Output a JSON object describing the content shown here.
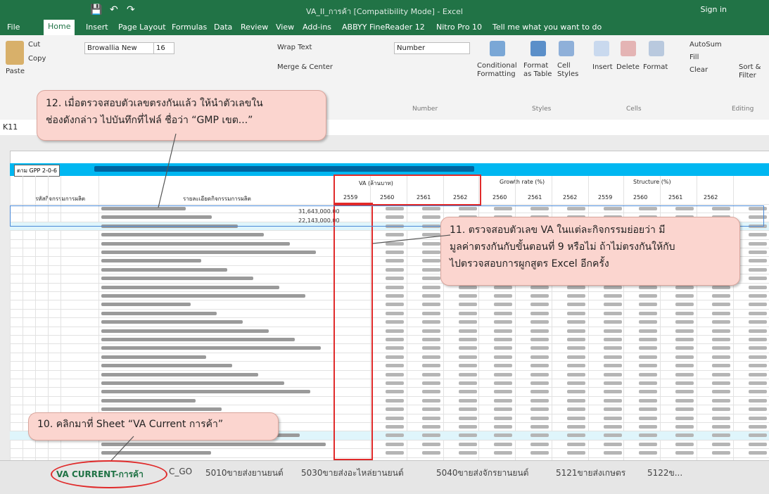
{
  "window": {
    "title": "VA_II_การค้า [Compatibility Mode] - Excel",
    "sign_in": "Sign in",
    "qa_save": "💾",
    "qa_undo": "↶",
    "qa_redo": "↷"
  },
  "ribbon_tabs": [
    "File",
    "Home",
    "Insert",
    "Page Layout",
    "Formulas",
    "Data",
    "Review",
    "View",
    "Add-ins",
    "ABBYY FineReader 12",
    "Nitro Pro 10",
    "Tell me what you want to do"
  ],
  "ribbon": {
    "cut": "Cut",
    "copy": "Copy",
    "paste": "Paste",
    "font_name": "Browallia New",
    "font_size": "16",
    "wrap_text": "Wrap Text",
    "merge_center": "Merge & Center",
    "number_format": "Number",
    "conditional_formatting": "Conditional Formatting",
    "format_as_table": "Format as Table",
    "cell_styles": "Cell Styles",
    "insert": "Insert",
    "delete": "Delete",
    "format": "Format",
    "autosum": "AutoSum",
    "fill": "Fill",
    "clear": "Clear",
    "sort_filter": "Sort & Filter",
    "group_styles": "Styles",
    "group_cells": "Cells",
    "group_editing": "Editing",
    "group_number": "Number"
  },
  "formula_bar": {
    "name_box": "K11"
  },
  "sheet": {
    "code": "ตาม GPP 2-0-6",
    "header_va": "VA (ล้านบาท)",
    "header_growth": "Growth rate (%)",
    "header_structure": "Structure (%)",
    "col_code": "รหัสกิจกรรมการผลิต",
    "col_name": "รายละเอียดกิจกรรมการผลิต",
    "years": [
      "2559",
      "2560",
      "2561",
      "2562"
    ],
    "row1_value": "31,643,000.00",
    "row2_value": "22,143,000.00"
  },
  "callouts": {
    "c12_line1": "12. เมื่อตรวจสอบตัวเลขตรงกันแล้ว ให้นำตัวเลขใน",
    "c12_line2": "ช่องดังกล่าว ไปบันทึกที่ไฟล์ ชื่อว่า “GMP เขต...”",
    "c11_line1": "11. ตรวจสอบตัวเลข VA ในแต่ละกิจกรรมย่อยว่า มี",
    "c11_line2": "มูลค่าตรงกันกับขั้นตอนที่ 9 หรือไม่ ถ้าไม่ตรงกันให้กับ",
    "c11_line3": "ไปตรวจสอบการผูกสูตร Excel อีกครั้ง",
    "c10_line1": "10. คลิกมาที่ Sheet “VA Current การค้า”"
  },
  "sheet_tabs": [
    "VA CURRENT-การค้า",
    "C_GO",
    "5010ขายส่งยานยนต์",
    "5030ขายส่งอะไหล่ยานยนต์",
    "5040ขายส่งจักรยานยนต์",
    "5121ขายส่งเกษตร",
    "5122ข..."
  ],
  "colors": {
    "excel_green": "#217346",
    "banner_blue": "#00b7f1",
    "callout_fill": "#fbd5cf",
    "highlight_red": "#e02a2a"
  }
}
